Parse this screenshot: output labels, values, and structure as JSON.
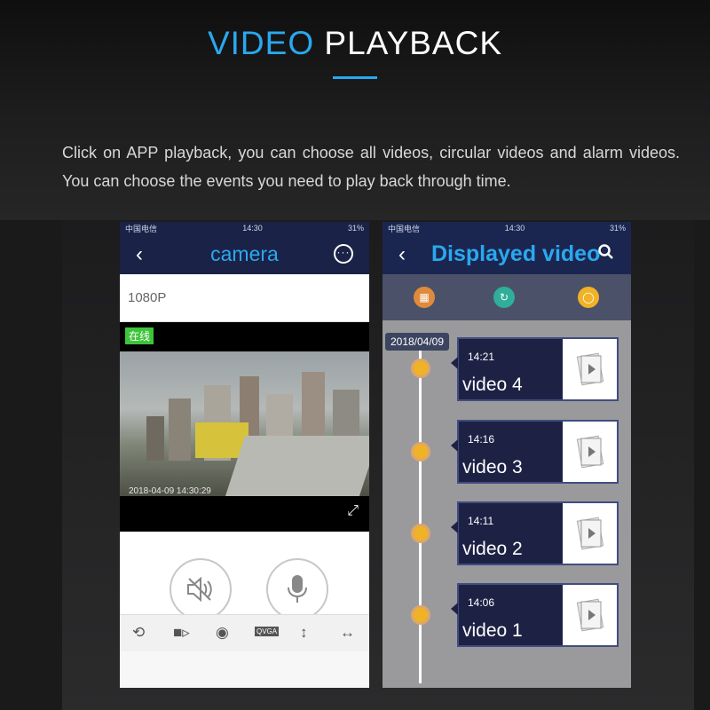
{
  "header": {
    "title_accent": "VIDEO",
    "title_rest": "PLAYBACK",
    "description": "Click on APP playback, you can choose all videos, circular videos and alarm videos. You can choose the events you need to play back through time."
  },
  "colors": {
    "accent": "#2aa8ef",
    "nav_bg": "#1a2247",
    "card_bg": "#1d2245",
    "node": "#f0b326",
    "online": "#3ec43a"
  },
  "phone_left": {
    "status": {
      "carrier": "中国电信",
      "time": "14:30",
      "battery": "31%"
    },
    "nav_title": "camera",
    "quality": "1080P",
    "online_badge": "在线",
    "timestamp": "2018-04-09  14:30:29",
    "icons": [
      "back-icon",
      "more-icon",
      "fullscreen-icon",
      "mute-icon",
      "microphone-icon",
      "playback-icon",
      "record-icon",
      "snapshot-icon",
      "qvga-icon",
      "flip-vertical-icon",
      "flip-horizontal-icon"
    ],
    "qvga_label": "QVGA"
  },
  "phone_right": {
    "status": {
      "carrier": "中国电信",
      "time": "14:30",
      "battery": "31%"
    },
    "nav_title": "Displayed video",
    "date": "2018/04/09",
    "videos": [
      {
        "time": "14:21",
        "name": "video 4"
      },
      {
        "time": "14:16",
        "name": "video 3"
      },
      {
        "time": "14:11",
        "name": "video 2"
      },
      {
        "time": "14:06",
        "name": "video 1"
      }
    ]
  }
}
